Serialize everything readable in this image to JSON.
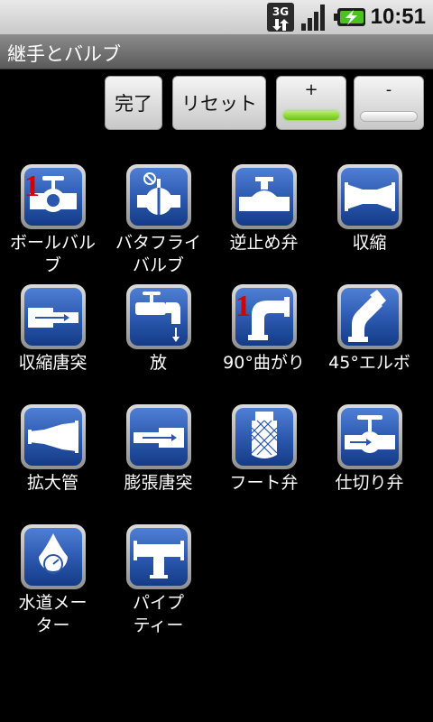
{
  "status_bar": {
    "network": "3G",
    "time": "10:51"
  },
  "title": "継手とバルブ",
  "buttons": {
    "done": "完了",
    "reset": "リセット",
    "plus": "+",
    "minus": "-",
    "plus_indicator": "on",
    "minus_indicator": "off"
  },
  "items": [
    {
      "label_line1": "ボールバル",
      "label_line2": "ブ",
      "count": "1",
      "icon": "ball-valve-icon"
    },
    {
      "label_line1": "バタフライ",
      "label_line2": "バルブ",
      "count": "",
      "icon": "butterfly-valve-icon"
    },
    {
      "label_line1": "逆止め弁",
      "label_line2": "",
      "count": "",
      "icon": "check-valve-icon"
    },
    {
      "label_line1": "収縮",
      "label_line2": "",
      "count": "",
      "icon": "reducer-icon"
    },
    {
      "label_line1": "収縮唐突",
      "label_line2": "",
      "count": "",
      "icon": "sudden-contraction-icon"
    },
    {
      "label_line1": "放",
      "label_line2": "",
      "count": "",
      "icon": "faucet-icon"
    },
    {
      "label_line1": "90°曲がり",
      "label_line2": "",
      "count": "1",
      "icon": "elbow-90-icon"
    },
    {
      "label_line1": "45°エルボ",
      "label_line2": "",
      "count": "",
      "icon": "elbow-45-icon"
    },
    {
      "label_line1": "拡大管",
      "label_line2": "",
      "count": "",
      "icon": "expander-icon"
    },
    {
      "label_line1": "膨張唐突",
      "label_line2": "",
      "count": "",
      "icon": "sudden-expansion-icon"
    },
    {
      "label_line1": "フート弁",
      "label_line2": "",
      "count": "",
      "icon": "foot-valve-icon"
    },
    {
      "label_line1": "仕切り弁",
      "label_line2": "",
      "count": "",
      "icon": "gate-valve-icon"
    },
    {
      "label_line1": "水道メー",
      "label_line2": "ター",
      "count": "",
      "icon": "water-meter-icon"
    },
    {
      "label_line1": "パイプ",
      "label_line2": "ティー",
      "count": "",
      "icon": "pipe-tee-icon"
    }
  ]
}
